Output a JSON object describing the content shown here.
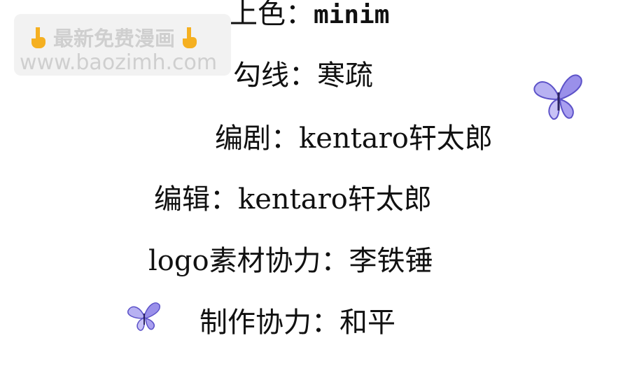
{
  "watermark": {
    "title": "最新免费漫画",
    "url": "www.baozimh.com",
    "icon": "pointing-hand-icon",
    "color": "#cfcfcf"
  },
  "credits": [
    {
      "text": "上色：",
      "value": "minim"
    },
    {
      "text": "勾线：寒疏"
    },
    {
      "text": "编剧：kentaro轩太郎"
    },
    {
      "text": "编辑：kentaro轩太郎"
    },
    {
      "text": "logo素材协力：李铁锤"
    },
    {
      "text": "制作协力：和平"
    }
  ],
  "decorations": [
    "butterfly-icon",
    "butterfly-icon"
  ],
  "colors": {
    "text": "#111111",
    "background": "#ffffff",
    "butterfly": "#8a7ee0"
  }
}
